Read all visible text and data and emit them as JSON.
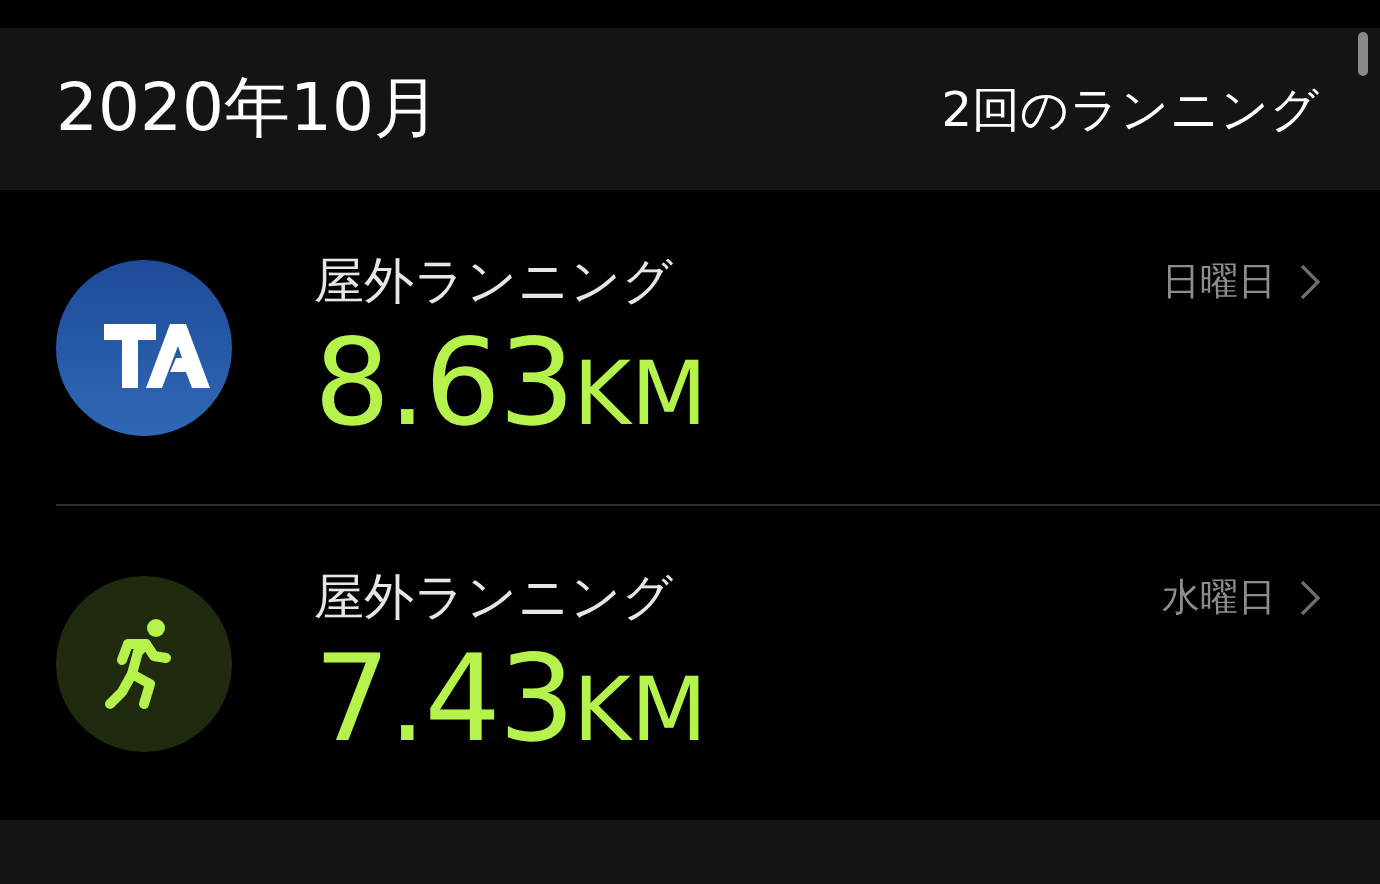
{
  "section": {
    "title": "2020年10月",
    "summary": "2回のランニング"
  },
  "workouts": [
    {
      "kind": "logo",
      "title": "屋外ランニング",
      "distance": "8.63",
      "unit": "KM",
      "day": "日曜日"
    },
    {
      "kind": "runner",
      "title": "屋外ランニング",
      "distance": "7.43",
      "unit": "KM",
      "day": "水曜日"
    }
  ],
  "next_section": {
    "kind": "header"
  }
}
